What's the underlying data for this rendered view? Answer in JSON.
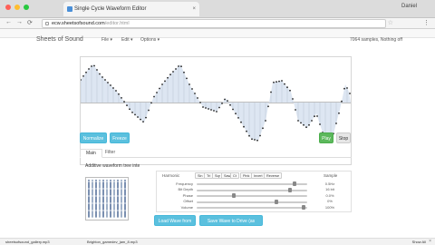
{
  "browser": {
    "tab_title": "Single Cycle Waveform Editor",
    "tab_close": "×",
    "user": "Daniel",
    "url_host": "ecw.sheetsofsound.com",
    "url_path": "/editor.html",
    "back": "←",
    "forward": "→",
    "reload": "⟳",
    "star": "☆",
    "menu": "⋮",
    "colors": {
      "close": "#ff5f57",
      "min": "#ffbd2e",
      "max": "#28c940"
    }
  },
  "navbar": {
    "brand": "Sheets of Sound",
    "menus": [
      "File ▾",
      "Edit ▾",
      "Options ▾"
    ],
    "status": "7064 samples, Nothing off"
  },
  "actions": {
    "normalize": "Normalize",
    "freeze": "Freeze",
    "play": "Play",
    "stop": "Stop"
  },
  "tabs": [
    "Main",
    "Filter"
  ],
  "additive": {
    "title": "Additive waveform tree inte",
    "header_label": "Harmonic",
    "buttons": [
      "Sin",
      "Tri",
      "Sqr",
      "Saw",
      "Ct",
      "Pink",
      "Invert",
      "Reverse"
    ],
    "value_header": "Sample",
    "rows": [
      {
        "label": "Frequency",
        "value": "0.5Hz",
        "level": 0.9
      },
      {
        "label": "Bit Depth",
        "value": "16 bit",
        "level": 0.86
      },
      {
        "label": "Phase",
        "value": "0.0%",
        "level": 0.33
      },
      {
        "label": "Offset",
        "value": "0%",
        "level": 0.73
      },
      {
        "label": "Volume",
        "value": "100%",
        "level": 0.98
      }
    ]
  },
  "footer_buttons": {
    "load": "Load Wave from Drive",
    "save": "Save Wave to Drive (as server)"
  },
  "taskbar": {
    "items": [
      "sheetsofsound_gallery.mp3",
      "Brighton_gamedev_jam_8.mp3"
    ],
    "show_all": "Show All",
    "close": "×"
  }
}
